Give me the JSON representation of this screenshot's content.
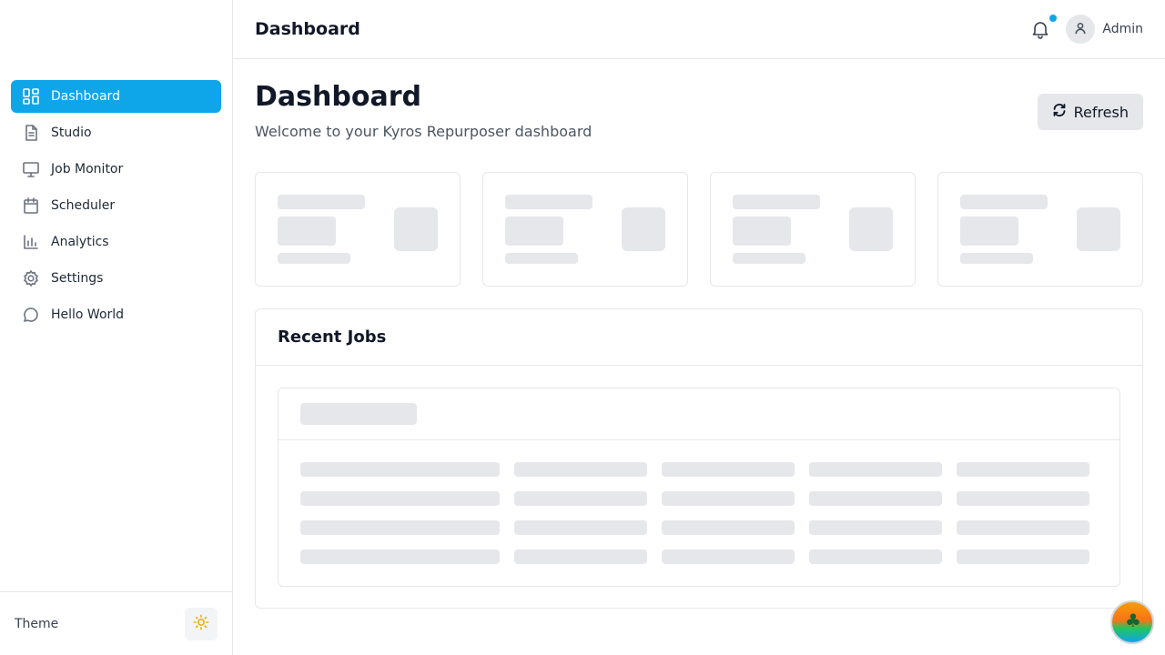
{
  "sidebar": {
    "items": [
      {
        "label": "Dashboard",
        "icon": "dashboard-icon"
      },
      {
        "label": "Studio",
        "icon": "document-icon"
      },
      {
        "label": "Job Monitor",
        "icon": "monitor-icon"
      },
      {
        "label": "Scheduler",
        "icon": "calendar-icon"
      },
      {
        "label": "Analytics",
        "icon": "bar-chart-icon"
      },
      {
        "label": "Settings",
        "icon": "gear-icon"
      },
      {
        "label": "Hello World",
        "icon": "chat-bubble-icon"
      }
    ],
    "active": "Dashboard",
    "theme_label": "Theme",
    "theme_icon": "sun-icon"
  },
  "header": {
    "title": "Dashboard",
    "notification_icon": "bell-icon",
    "user_name": "Admin"
  },
  "main": {
    "title": "Dashboard",
    "subtitle": "Welcome to your Kyros Repurposer dashboard",
    "refresh_label": "Refresh",
    "recent_jobs_title": "Recent Jobs"
  },
  "colors": {
    "accent": "#0ea5e9",
    "skeleton": "#e5e7eb",
    "border": "#e5e7eb"
  }
}
